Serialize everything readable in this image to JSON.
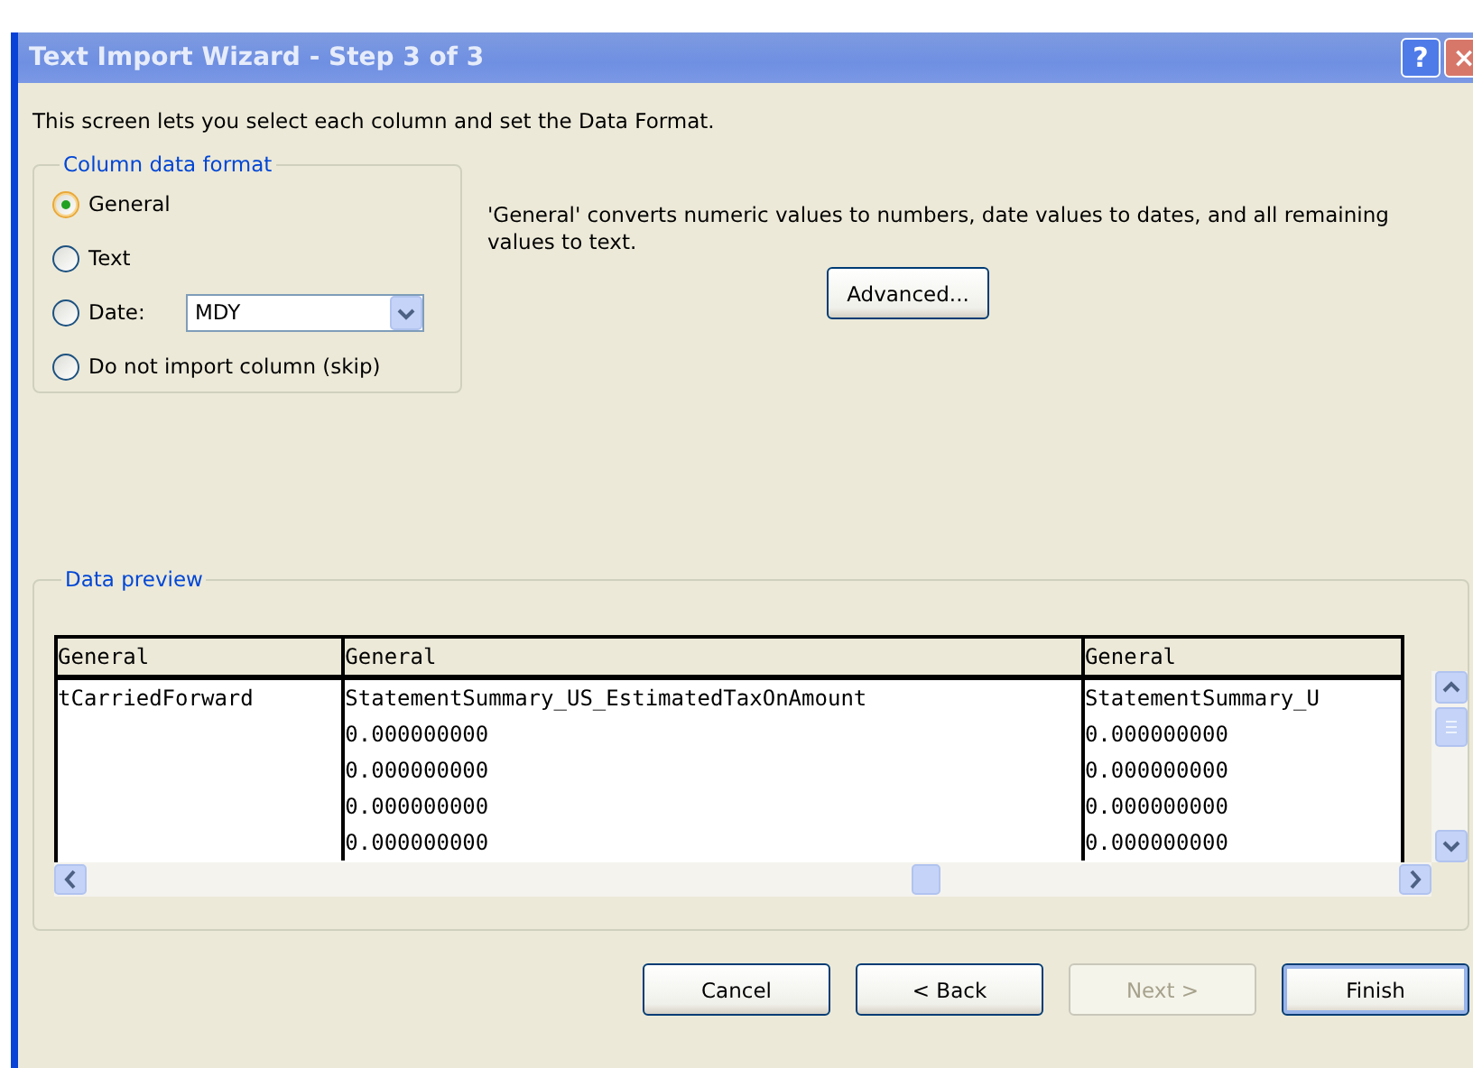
{
  "window": {
    "title": "Text Import Wizard - Step 3 of 3"
  },
  "title_buttons": [
    {
      "kind": "help",
      "label": "?"
    },
    {
      "kind": "close",
      "label": "×"
    }
  ],
  "intro": "This screen lets you select each column and set the Data Format.",
  "column_data_format": {
    "legend": "Column data format",
    "options": [
      {
        "kind": "plain",
        "label": "General",
        "selected": true
      },
      {
        "kind": "plain",
        "label": "Text",
        "selected": false
      },
      {
        "kind": "date",
        "label": "Date:",
        "selected": false,
        "value": "MDY"
      },
      {
        "kind": "plain",
        "label": "Do not import column (skip)",
        "selected": false
      }
    ]
  },
  "description": "'General' converts numeric values to numbers, date values to dates, and all remaining values to text.",
  "advanced_button": "Advanced...",
  "data_preview": {
    "legend": "Data preview",
    "columns": [
      "General",
      "General",
      "General"
    ],
    "rows": [
      [
        "tCarriedForward",
        "StatementSummary_US_EstimatedTaxOnAmount",
        "StatementSummary_U"
      ],
      [
        "",
        "0.000000000",
        "0.000000000"
      ],
      [
        "",
        "0.000000000",
        "0.000000000"
      ],
      [
        "",
        "0.000000000",
        "0.000000000"
      ],
      [
        "",
        "0.000000000",
        "0.000000000"
      ]
    ]
  },
  "buttons": [
    {
      "label": "Cancel",
      "disabled": false,
      "default": false
    },
    {
      "label": "< Back",
      "disabled": false,
      "default": false
    },
    {
      "label": "Next >",
      "disabled": true,
      "default": false
    },
    {
      "label": "Finish",
      "disabled": false,
      "default": true
    }
  ]
}
